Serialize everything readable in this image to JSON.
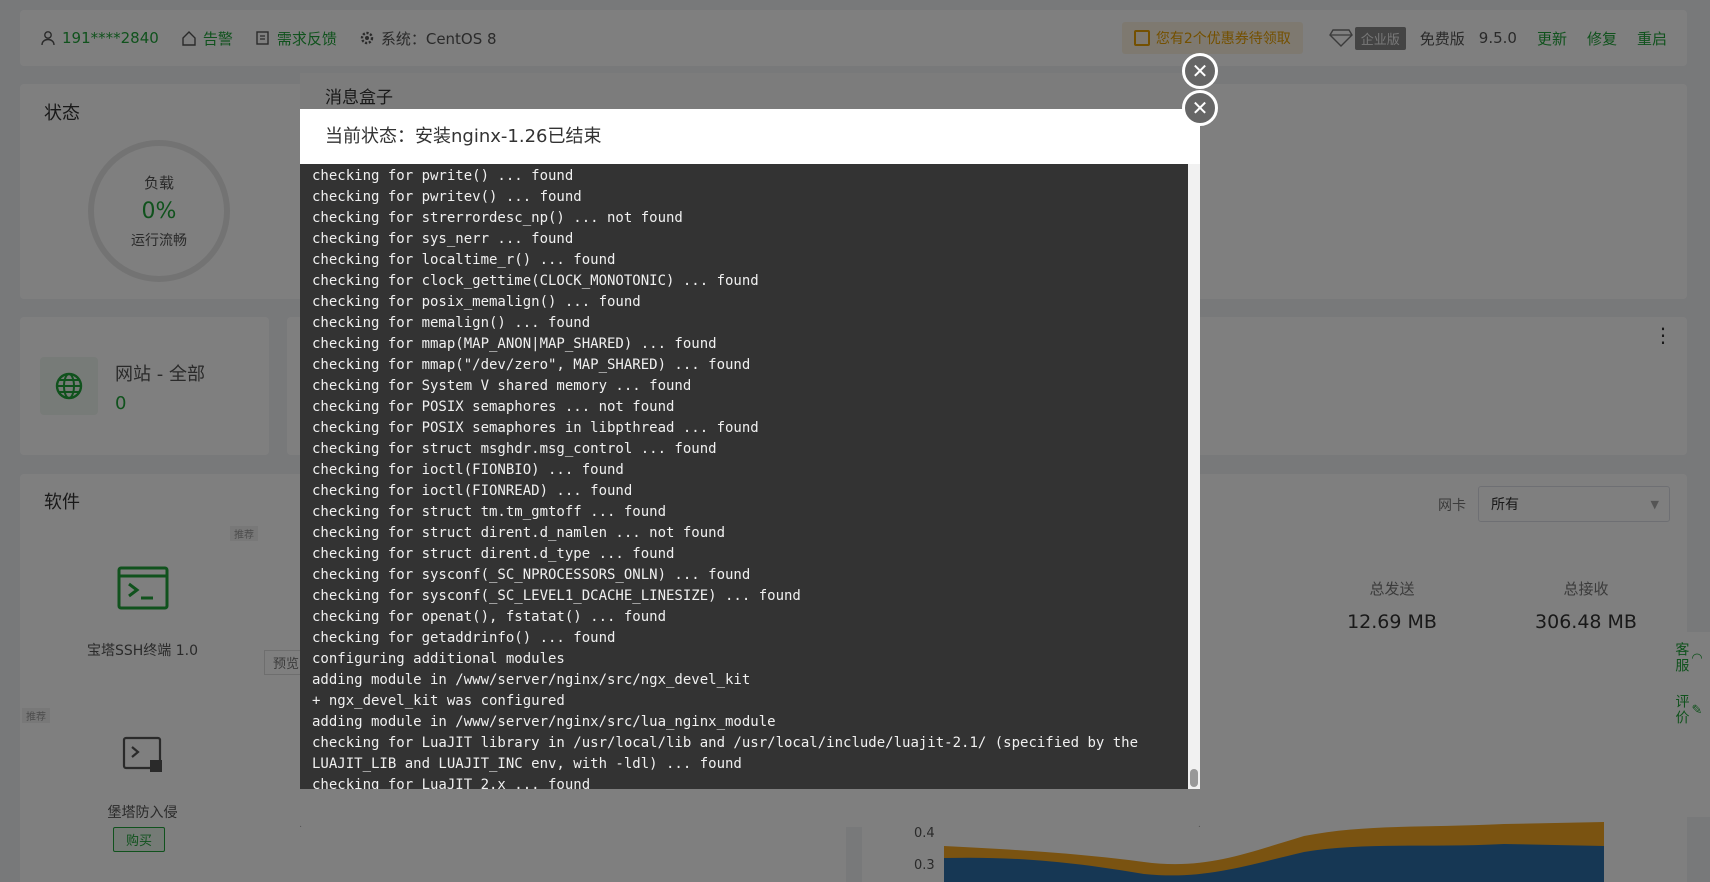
{
  "topbar": {
    "user": "191****2840",
    "alarm": "告警",
    "feedback": "需求反馈",
    "system": "系统：CentOS 8",
    "promo": "您有2个优惠券待领取",
    "edition_badge": "企业版",
    "edition": "免费版",
    "version": "9.5.0",
    "update": "更新",
    "repair": "修复",
    "restart": "重启"
  },
  "status": {
    "title": "状态",
    "load_label": "负载",
    "load_value": "0%",
    "load_state": "运行流畅"
  },
  "site": {
    "label": "网站 - 全部",
    "count": "0"
  },
  "software": {
    "title": "软件",
    "items": [
      {
        "name": "宝塔SSH终端 1.0",
        "tag": "推荐",
        "action": "预览"
      },
      {
        "name": "堡塔防入侵",
        "tag": "推荐",
        "action": "购买"
      }
    ]
  },
  "traffic": {
    "nic_label": "网卡",
    "nic_value": "所有",
    "sent_label": "总发送",
    "sent_value": "12.69 MB",
    "recv_label": "总接收",
    "recv_value": "306.48 MB",
    "y_ticks": [
      "0.4",
      "0.3"
    ]
  },
  "float_bar": {
    "service": "客服",
    "review": "评价"
  },
  "modal_back": {
    "title": "消息盒子"
  },
  "modal_front": {
    "title": "当前状态：安装nginx-1.26已结束",
    "log": "checking for pwrite() ... found\nchecking for pwritev() ... found\nchecking for strerrordesc_np() ... not found\nchecking for sys_nerr ... found\nchecking for localtime_r() ... found\nchecking for clock_gettime(CLOCK_MONOTONIC) ... found\nchecking for posix_memalign() ... found\nchecking for memalign() ... found\nchecking for mmap(MAP_ANON|MAP_SHARED) ... found\nchecking for mmap(\"/dev/zero\", MAP_SHARED) ... found\nchecking for System V shared memory ... found\nchecking for POSIX semaphores ... not found\nchecking for POSIX semaphores in libpthread ... found\nchecking for struct msghdr.msg_control ... found\nchecking for ioctl(FIONBIO) ... found\nchecking for ioctl(FIONREAD) ... found\nchecking for struct tm.tm_gmtoff ... found\nchecking for struct dirent.d_namlen ... not found\nchecking for struct dirent.d_type ... found\nchecking for sysconf(_SC_NPROCESSORS_ONLN) ... found\nchecking for sysconf(_SC_LEVEL1_DCACHE_LINESIZE) ... found\nchecking for openat(), fstatat() ... found\nchecking for getaddrinfo() ... found\nconfiguring additional modules\nadding module in /www/server/nginx/src/ngx_devel_kit\n+ ngx_devel_kit was configured\nadding module in /www/server/nginx/src/lua_nginx_module\nchecking for LuaJIT library in /usr/local/lib and /usr/local/include/luajit-2.1/ (specified by the\nLUAJIT_LIB and LUAJIT_INC env, with -ldl) ... found\nchecking for LuaJIT 2.x ... found"
  },
  "colors": {
    "accent": "#20a53a",
    "console_bg": "#333333",
    "console_text": "#f0f0f0"
  }
}
